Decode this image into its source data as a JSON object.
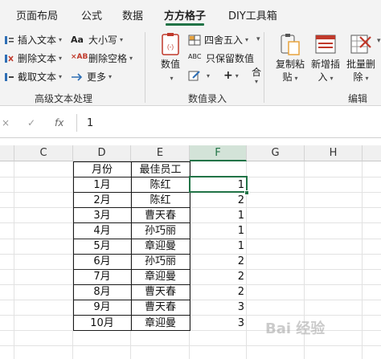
{
  "tabs": [
    {
      "label": "页面布局",
      "active": false
    },
    {
      "label": "公式",
      "active": false
    },
    {
      "label": "数据",
      "active": false
    },
    {
      "label": "方方格子",
      "active": true
    },
    {
      "label": "DIY工具箱",
      "active": false
    }
  ],
  "ribbon": {
    "text_group": {
      "insert_text": "插入文本",
      "delete_text": "删除文本",
      "cut_text": "截取文本",
      "case": "大小写",
      "delete_spaces": "删除空格",
      "more": "更多",
      "label": "高级文本处理",
      "case_icon_text": "Aa",
      "delete_spaces_icon_text": "×AB"
    },
    "number_group": {
      "value": "数值",
      "round": "四舍五入",
      "keep_value": "只保留数值",
      "label": "数值录入",
      "keep_value_icon_text": "ABC",
      "plus_sign": "+",
      "truncated": "合"
    },
    "edit_group": {
      "copy_paste_line1": "复制粘",
      "copy_paste_line2": "贴",
      "insert_line1": "新增插",
      "insert_line2": "入",
      "batch_delete_line1": "批量删",
      "batch_delete_line2": "除",
      "label": "编辑"
    }
  },
  "formula_bar": {
    "cancel": "×",
    "confirm": "✓",
    "fx": "fx",
    "value": "1"
  },
  "columns": [
    "C",
    "D",
    "E",
    "F",
    "G",
    "H"
  ],
  "table": {
    "headers": [
      "月份",
      "最佳员工"
    ],
    "rows": [
      {
        "month": "1月",
        "employee": "陈红",
        "value": "1"
      },
      {
        "month": "2月",
        "employee": "陈红",
        "value": "2"
      },
      {
        "month": "3月",
        "employee": "曹天春",
        "value": "1"
      },
      {
        "month": "4月",
        "employee": "孙巧丽",
        "value": "1"
      },
      {
        "month": "5月",
        "employee": "章迎曼",
        "value": "1"
      },
      {
        "month": "6月",
        "employee": "孙巧丽",
        "value": "2"
      },
      {
        "month": "7月",
        "employee": "章迎曼",
        "value": "2"
      },
      {
        "month": "8月",
        "employee": "曹天春",
        "value": "2"
      },
      {
        "month": "9月",
        "employee": "曹天春",
        "value": "3"
      },
      {
        "month": "10月",
        "employee": "章迎曼",
        "value": "3"
      }
    ]
  },
  "watermark": "Bai 经验",
  "colors": {
    "accent": "#217346",
    "ribbon_bg": "#f3f3f3",
    "icon_red": "#c0392b",
    "icon_blue": "#2f6fb5"
  }
}
